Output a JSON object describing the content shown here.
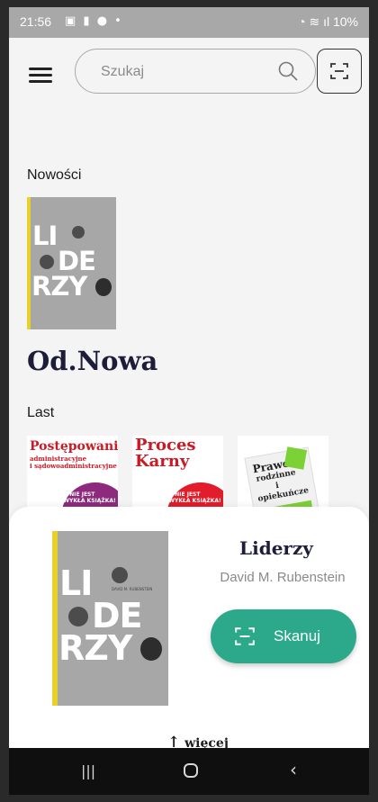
{
  "status": {
    "time": "21:56",
    "battery": "10%"
  },
  "search": {
    "placeholder": "Szukaj"
  },
  "sections": {
    "new": "Nowości",
    "brand": "Od.Nowa",
    "last": "Last"
  },
  "covers": {
    "liderzy": {
      "word1": "LI",
      "word2": "DE",
      "word3": "RZY",
      "author": "DAVID M. RUBENSTEIN"
    },
    "postepowanie": {
      "title": "Postępowanie",
      "sub": "administracyjne\ni sądowoadministracyjne",
      "tag": "TO NIE JEST\nZWYKŁA KSIĄŻKA!"
    },
    "proces": {
      "title1": "Proces",
      "title2": "Karny",
      "tag": "TO NIE JEST\nZWYKŁA KSIĄŻKA!"
    },
    "prawo": {
      "t1": "Prawo",
      "t2": "rodzinne",
      "t3": "i",
      "t4": "opiekuńcze"
    }
  },
  "sheet": {
    "title": "Liderzy",
    "author": "David M. Rubenstein",
    "scan_label": "Skanuj",
    "more_label": "więcej"
  },
  "icons": {
    "menu": "hamburger-menu-icon",
    "search": "search-icon",
    "scan": "barcode-scan-icon",
    "arrow_up": "arrow-up-icon"
  },
  "colors": {
    "accent": "#2ba98a",
    "brand": "#1d1d3a",
    "red": "#c91a26"
  }
}
